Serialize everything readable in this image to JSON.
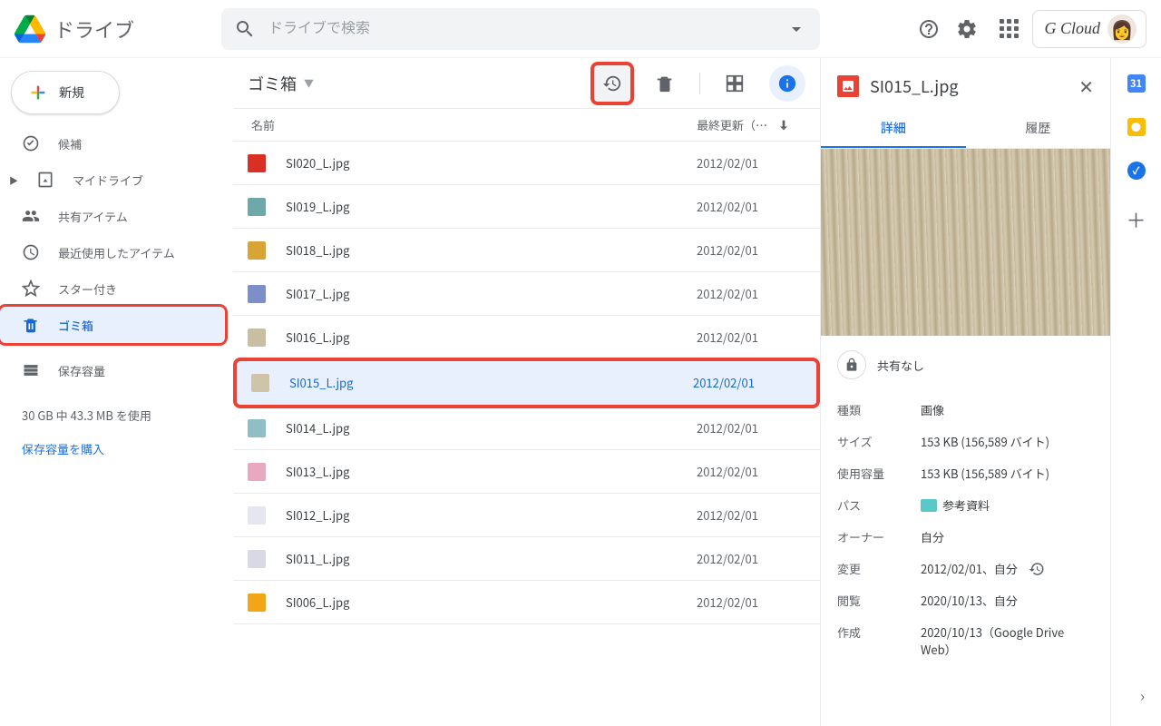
{
  "header": {
    "app_name": "ドライブ",
    "search_placeholder": "ドライブで検索",
    "profile_label": "G Cloud"
  },
  "sidebar": {
    "new_label": "新規",
    "items": [
      {
        "label": "候補"
      },
      {
        "label": "マイドライブ"
      },
      {
        "label": "共有アイテム"
      },
      {
        "label": "最近使用したアイテム"
      },
      {
        "label": "スター付き"
      },
      {
        "label": "ゴミ箱"
      },
      {
        "label": "保存容量"
      }
    ],
    "storage_usage": "30 GB 中 43.3 MB を使用",
    "storage_link": "保存容量を購入"
  },
  "toolbar": {
    "breadcrumb": "ゴミ箱"
  },
  "columns": {
    "name": "名前",
    "modified": "最終更新（…"
  },
  "files": [
    {
      "name": "SI020_L.jpg",
      "date": "2012/02/01",
      "color": "#d93025"
    },
    {
      "name": "SI019_L.jpg",
      "date": "2012/02/01",
      "color": "#6fa8a8"
    },
    {
      "name": "SI018_L.jpg",
      "date": "2012/02/01",
      "color": "#d9a436"
    },
    {
      "name": "SI017_L.jpg",
      "date": "2012/02/01",
      "color": "#7c8fc9"
    },
    {
      "name": "SI016_L.jpg",
      "date": "2012/02/01",
      "color": "#c9bfa0"
    },
    {
      "name": "SI015_L.jpg",
      "date": "2012/02/01",
      "color": "#cfc4a7",
      "selected": true
    },
    {
      "name": "SI014_L.jpg",
      "date": "2012/02/01",
      "color": "#8fbfc4"
    },
    {
      "name": "SI013_L.jpg",
      "date": "2012/02/01",
      "color": "#e8a8bf"
    },
    {
      "name": "SI012_L.jpg",
      "date": "2012/02/01",
      "color": "#e6e6ef"
    },
    {
      "name": "SI011_L.jpg",
      "date": "2012/02/01",
      "color": "#d9d9e6"
    },
    {
      "name": "SI006_L.jpg",
      "date": "2012/02/01",
      "color": "#f2a516"
    }
  ],
  "details": {
    "filename": "SI015_L.jpg",
    "tabs": {
      "details": "詳細",
      "activity": "履歴"
    },
    "share_label": "共有なし",
    "props": {
      "type_k": "種類",
      "type_v": "画像",
      "size_k": "サイズ",
      "size_v": "153 KB (156,589 バイト)",
      "used_k": "使用容量",
      "used_v": "153 KB (156,589 バイト)",
      "path_k": "パス",
      "path_v": "参考資料",
      "owner_k": "オーナー",
      "owner_v": "自分",
      "modified_k": "変更",
      "modified_v": "2012/02/01、自分",
      "viewed_k": "閲覧",
      "viewed_v": "2020/10/13、自分",
      "created_k": "作成",
      "created_v": "2020/10/13（Google Drive Web）"
    }
  }
}
